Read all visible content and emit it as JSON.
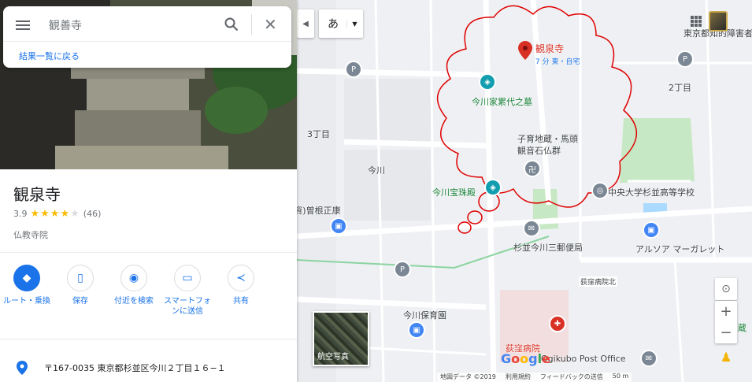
{
  "search": {
    "query": "観善寺",
    "back_link": "結果一覧に戻る"
  },
  "place": {
    "name": "観泉寺",
    "rating": "3.9",
    "review_count": "(46)",
    "category": "仏教寺院",
    "address": "〒167-0035 東京都杉並区今川２丁目１６−１"
  },
  "actions": [
    {
      "label": "ルート・乗換",
      "icon": "directions-icon"
    },
    {
      "label": "保存",
      "icon": "bookmark-icon"
    },
    {
      "label": "付近を検索",
      "icon": "nearby-icon"
    },
    {
      "label": "スマートフォンに送信",
      "icon": "send-to-phone-icon"
    },
    {
      "label": "共有",
      "icon": "share-icon"
    }
  ],
  "map": {
    "input_mode": "あ",
    "place_marker": {
      "name": "観泉寺",
      "sub": "7 分 東・自宅"
    },
    "labels": {
      "l1": "今川家累代之墓",
      "l2": "子育地蔵・馬頭",
      "l2b": "観音石仏群",
      "l3": "今川宝珠殿",
      "l4": "(資)曽根正康",
      "l5": "中央大学杉並高等学校",
      "l6": "杉並今川三郵便局",
      "l7": "アルソア マーガレット",
      "l8": "荻窪病院",
      "l9": "今川保育園",
      "l10": "荻窪病院北",
      "l11": "Ogikubo Post Office",
      "l12": "3丁目",
      "l13": "今川",
      "l14": "2丁目",
      "l15": "東京都知的障害者",
      "l16": "蔵"
    },
    "satellite_label": "航空写真",
    "attribution": [
      "地図データ ©2019",
      "利用規約",
      "フィードバックの送信",
      "50 m"
    ]
  },
  "colors": {
    "accent": "#1a73e8",
    "marker": "#d93025",
    "annotation": "#e00000",
    "park": "#c7e8c4"
  }
}
